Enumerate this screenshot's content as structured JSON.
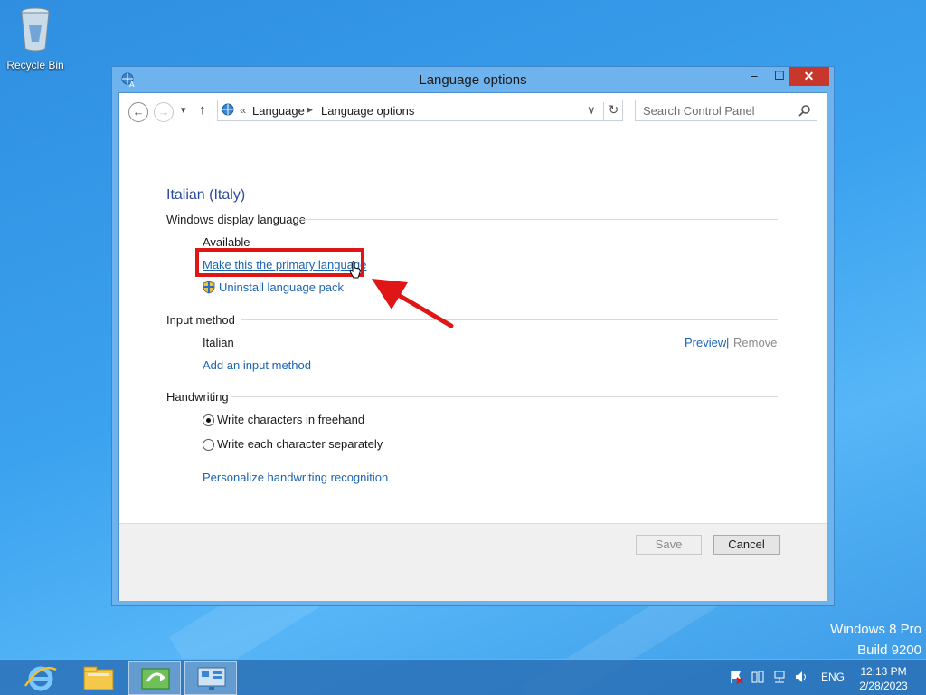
{
  "desktop": {
    "recycle_bin_label": "Recycle Bin",
    "watermark_line1": "Windows 8 Pro",
    "watermark_line2": "Build 9200"
  },
  "window": {
    "title": "Language options",
    "minimize_glyph": "–",
    "maximize_glyph": "☐",
    "close_glyph": "✕"
  },
  "nav": {
    "back_glyph": "←",
    "forward_glyph": "→",
    "recent_glyph": "▾",
    "up_glyph": "↑",
    "breadcrumb_overflow": "«",
    "breadcrumb": [
      "Language",
      "Language options"
    ],
    "breadcrumb_sep": "▶",
    "dropdown_glyph": "∨",
    "refresh_glyph": "↻",
    "search_placeholder": "Search Control Panel",
    "search_icon": "search-icon"
  },
  "content": {
    "language_title": "Italian (Italy)",
    "display_language": {
      "header": "Windows display language",
      "status": "Available",
      "make_primary_link": "Make this the primary language",
      "uninstall_link": "Uninstall language pack"
    },
    "input_method": {
      "header": "Input method",
      "method_name": "Italian",
      "preview_link": "Preview",
      "separator": "|",
      "remove_link": "Remove",
      "add_link": "Add an input method"
    },
    "handwriting": {
      "header": "Handwriting",
      "option_freehand": "Write characters in freehand",
      "option_separate": "Write each character separately",
      "selected": "freehand",
      "personalize_link": "Personalize handwriting recognition"
    }
  },
  "footer": {
    "save_label": "Save",
    "cancel_label": "Cancel"
  },
  "taskbar": {
    "language": "ENG",
    "time": "12:13 PM",
    "date": "2/28/2023"
  },
  "colors": {
    "link": "#1a64b4",
    "highlight": "#e01515",
    "close_button": "#c7372b"
  }
}
